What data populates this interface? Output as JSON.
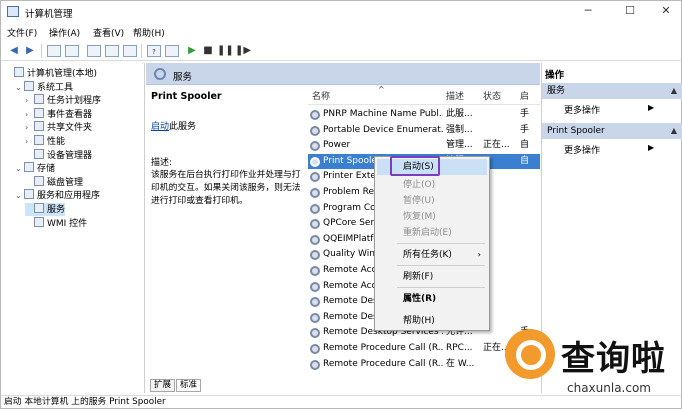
{
  "window": {
    "title": "计算机管理"
  },
  "menu": [
    "文件(F)",
    "操作(A)",
    "查看(V)",
    "帮助(H)"
  ],
  "tree": [
    {
      "label": "计算机管理(本地)",
      "level": 0,
      "arrow": ""
    },
    {
      "label": "系统工具",
      "level": 1,
      "arrow": "⌄"
    },
    {
      "label": "任务计划程序",
      "level": 2,
      "arrow": "›"
    },
    {
      "label": "事件查看器",
      "level": 2,
      "arrow": "›"
    },
    {
      "label": "共享文件夹",
      "level": 2,
      "arrow": "›"
    },
    {
      "label": "性能",
      "level": 2,
      "arrow": "›"
    },
    {
      "label": "设备管理器",
      "level": 2,
      "arrow": ""
    },
    {
      "label": "存储",
      "level": 1,
      "arrow": "⌄"
    },
    {
      "label": "磁盘管理",
      "level": 2,
      "arrow": ""
    },
    {
      "label": "服务和应用程序",
      "level": 1,
      "arrow": "⌄"
    },
    {
      "label": "服务",
      "level": 2,
      "arrow": "",
      "selected": true
    },
    {
      "label": "WMI 控件",
      "level": 2,
      "arrow": ""
    }
  ],
  "services_header": "服务",
  "details": {
    "name": "Print Spooler",
    "start_link": "启动",
    "start_suffix": "此服务",
    "desc_label": "描述:",
    "desc": "该服务在后台执行打印作业并处理与打印机的交互。如果关闭该服务，则无法进行打印或查看打印机。"
  },
  "columns": {
    "name": "名称",
    "desc": "描述",
    "status": "状态",
    "startup": "启"
  },
  "rows": [
    {
      "name": "PNRP Machine Name Publ...",
      "desc": "此服...",
      "status": "",
      "startup": "手"
    },
    {
      "name": "Portable Device Enumerat...",
      "desc": "强制...",
      "status": "",
      "startup": "手"
    },
    {
      "name": "Power",
      "desc": "管理...",
      "status": "正在...",
      "startup": "自"
    },
    {
      "name": "Print Spooler",
      "desc": "该服",
      "status": "",
      "startup": "自",
      "highlight": true
    },
    {
      "name": "Printer Extens",
      "desc": "",
      "status": "",
      "startup": ""
    },
    {
      "name": "Problem Repo",
      "desc": "",
      "status": "",
      "startup": ""
    },
    {
      "name": "Program Com",
      "desc": "",
      "status": "",
      "startup": ""
    },
    {
      "name": "QPCore Serv",
      "desc": "",
      "status": "",
      "startup": ""
    },
    {
      "name": "QQEIMPlatfo",
      "desc": "",
      "status": "",
      "startup": ""
    },
    {
      "name": "Quality Wind",
      "desc": "",
      "status": "",
      "startup": ""
    },
    {
      "name": "Remote Acce",
      "desc": "",
      "status": "",
      "startup": ""
    },
    {
      "name": "Remote Acce",
      "desc": "",
      "status": "",
      "startup": ""
    },
    {
      "name": "Remote Desk",
      "desc": "",
      "status": "",
      "startup": ""
    },
    {
      "name": "Remote Desk",
      "desc": "",
      "status": "",
      "startup": ""
    },
    {
      "name": "Remote Desktop Services ...",
      "desc": "允许...",
      "status": "",
      "startup": "手"
    },
    {
      "name": "Remote Procedure Call (R...",
      "desc": "RPC...",
      "status": "正在...",
      "startup": "自"
    },
    {
      "name": "Remote Procedure Call (R...",
      "desc": "在 W...",
      "status": "",
      "startup": "手"
    }
  ],
  "tabs": [
    "扩展",
    "标准"
  ],
  "actions": {
    "title": "操作",
    "sections": [
      {
        "label": "服务",
        "item": "更多操作"
      },
      {
        "label": "Print Spooler",
        "item": "更多操作"
      }
    ]
  },
  "context_menu": [
    {
      "label": "启动(S)",
      "disabled": false,
      "bold": false,
      "highlight": true
    },
    {
      "label": "停止(O)",
      "disabled": true
    },
    {
      "label": "暂停(U)",
      "disabled": true
    },
    {
      "label": "恢复(M)",
      "disabled": true
    },
    {
      "label": "重新启动(E)",
      "disabled": true
    },
    {
      "label": "所有任务(K)",
      "disabled": false,
      "submenu": true
    },
    {
      "label": "刷新(F)",
      "disabled": false
    },
    {
      "label": "属性(R)",
      "disabled": false,
      "bold": true
    },
    {
      "label": "帮助(H)",
      "disabled": false
    }
  ],
  "status_bar": "启动 本地计算机 上的服务 Print Spooler",
  "watermark": {
    "cn": "查询啦",
    "en": "chaxunla.com"
  },
  "colors": {
    "highlight": "#3b7fd0",
    "header": "#c9d6ea",
    "focus": "#7a3fbf",
    "logo": "#f39a2d"
  }
}
